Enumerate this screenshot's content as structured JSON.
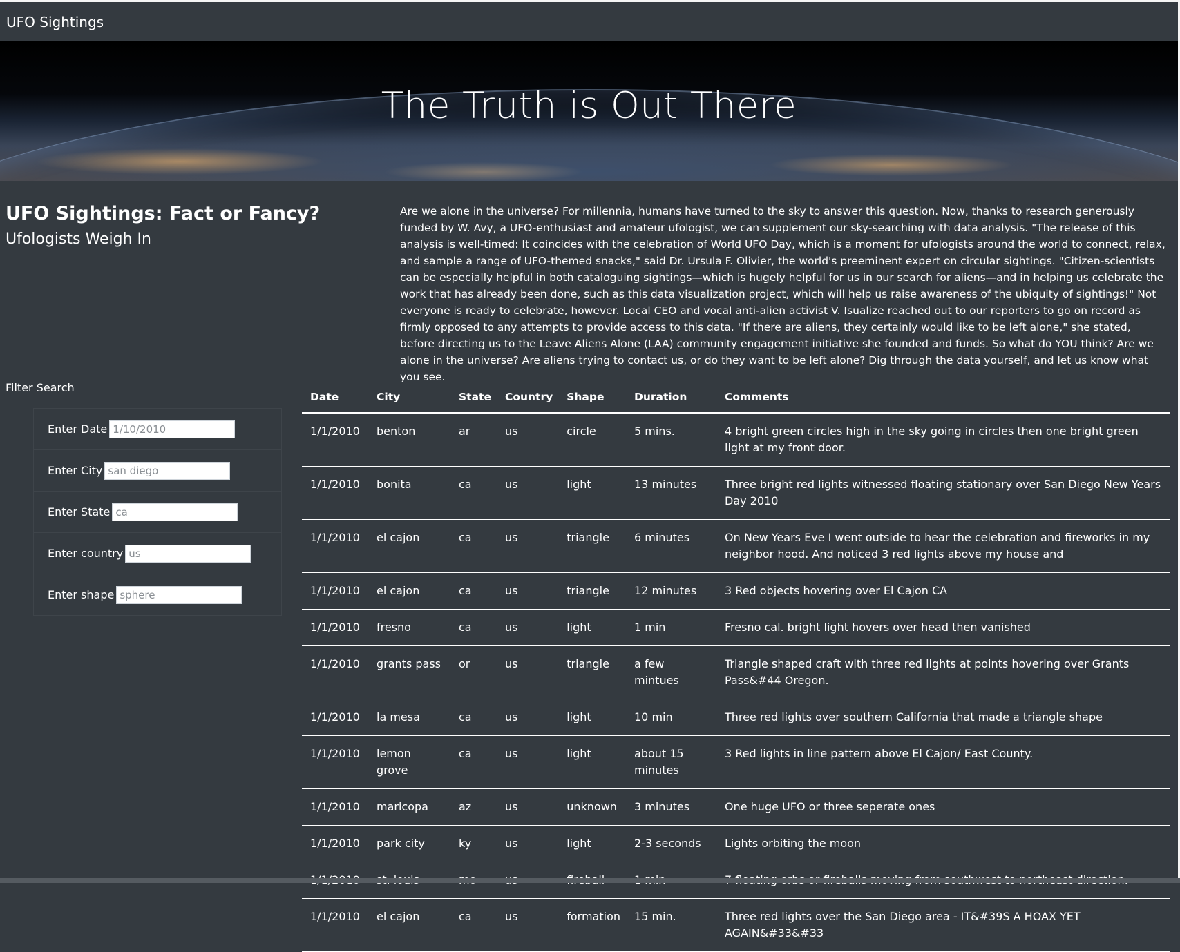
{
  "navbar": {
    "brand": "UFO Sightings"
  },
  "hero": {
    "title": "The Truth is Out There"
  },
  "article": {
    "title": "UFO Sightings: Fact or Fancy?",
    "subtitle": "Ufologists Weigh In",
    "body": "Are we alone in the universe? For millennia, humans have turned to the sky to answer this question. Now, thanks to research generously funded by W. Avy, a UFO-enthusiast and amateur ufologist, we can supplement our sky-searching with data analysis. \"The release of this analysis is well-timed: It coincides with the celebration of World UFO Day, which is a moment for ufologists around the world to connect, relax, and sample a range of UFO-themed snacks,\" said Dr. Ursula F. Olivier, the world's preeminent expert on circular sightings. \"Citizen-scientists can be especially helpful in both cataloguing sightings—which is hugely helpful for us in our search for aliens—and in helping us celebrate the work that has already been done, such as this data visualization project, which will help us raise awareness of the ubiquity of sightings!\" Not everyone is ready to celebrate, however. Local CEO and vocal anti-alien activist V. Isualize reached out to our reporters to go on record as firmly opposed to any attempts to provide access to this data. \"If there are aliens, they certainly would like to be left alone,\" she stated, before directing us to the Leave Aliens Alone (LAA) community engagement initiative she founded and funds. So what do YOU think? Are we alone in the universe? Are aliens trying to contact us, or do they want to be left alone? Dig through the data yourself, and let us know what you see."
  },
  "filters": {
    "heading": "Filter Search",
    "items": [
      {
        "label": "Enter Date",
        "placeholder": "1/10/2010"
      },
      {
        "label": "Enter City",
        "placeholder": "san diego"
      },
      {
        "label": "Enter State",
        "placeholder": "ca"
      },
      {
        "label": "Enter country",
        "placeholder": "us"
      },
      {
        "label": "Enter shape",
        "placeholder": "sphere"
      }
    ]
  },
  "table": {
    "headers": [
      "Date",
      "City",
      "State",
      "Country",
      "Shape",
      "Duration",
      "Comments"
    ],
    "rows": [
      [
        "1/1/2010",
        "benton",
        "ar",
        "us",
        "circle",
        "5 mins.",
        "4 bright green circles high in the sky going in circles then one bright green light at my front door."
      ],
      [
        "1/1/2010",
        "bonita",
        "ca",
        "us",
        "light",
        "13 minutes",
        "Three bright red lights witnessed floating stationary over San Diego New Years Day 2010"
      ],
      [
        "1/1/2010",
        "el cajon",
        "ca",
        "us",
        "triangle",
        "6 minutes",
        "On New Years Eve I went outside to hear the celebration and fireworks in my neighbor hood. And noticed 3 red lights above my house and"
      ],
      [
        "1/1/2010",
        "el cajon",
        "ca",
        "us",
        "triangle",
        "12 minutes",
        "3 Red objects hovering over El Cajon CA"
      ],
      [
        "1/1/2010",
        "fresno",
        "ca",
        "us",
        "light",
        "1 min",
        "Fresno cal. bright light hovers over head then vanished"
      ],
      [
        "1/1/2010",
        "grants pass",
        "or",
        "us",
        "triangle",
        "a few mintues",
        "Triangle shaped craft with three red lights at points hovering over Grants Pass&#44 Oregon."
      ],
      [
        "1/1/2010",
        "la mesa",
        "ca",
        "us",
        "light",
        "10 min",
        "Three red lights over southern California that made a triangle shape"
      ],
      [
        "1/1/2010",
        "lemon grove",
        "ca",
        "us",
        "light",
        "about 15 minutes",
        "3 Red lights in line pattern above El Cajon/ East County."
      ],
      [
        "1/1/2010",
        "maricopa",
        "az",
        "us",
        "unknown",
        "3 minutes",
        "One huge UFO or three seperate ones"
      ],
      [
        "1/1/2010",
        "park city",
        "ky",
        "us",
        "light",
        "2-3 seconds",
        "Lights orbiting the moon"
      ],
      [
        "1/1/2010",
        "st. louis",
        "mo",
        "us",
        "fireball",
        "1 min",
        "7 floating orbs or fireballs moving from southwest to northeast direction."
      ],
      [
        "1/1/2010",
        "el cajon",
        "ca",
        "us",
        "formation",
        "15 min.",
        "Three red lights over the San Diego area - IT&#39S A HOAX YET AGAIN&#33&#33"
      ]
    ]
  }
}
